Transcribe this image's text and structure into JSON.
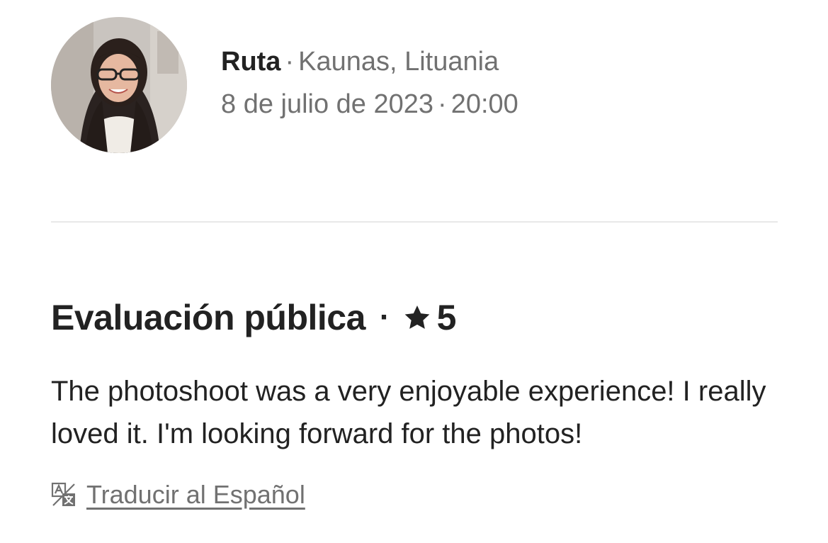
{
  "reviewer": {
    "name": "Ruta",
    "location": "Kaunas, Lituania",
    "date": "8 de julio de 2023",
    "time": "20:00",
    "separator": "·",
    "avatar_icon": "profile-photo"
  },
  "review": {
    "title": "Evaluación pública",
    "separator": "·",
    "star_icon": "star-icon",
    "rating": "5",
    "text": "The photoshoot was a very enjoyable experience! I really loved it. I'm looking forward for the photos!"
  },
  "translate": {
    "icon": "translate-icon",
    "label": "Traducir al Español"
  },
  "colors": {
    "primary_text": "#222222",
    "secondary_text": "#717171",
    "divider": "#e8e8e8",
    "background": "#ffffff"
  }
}
